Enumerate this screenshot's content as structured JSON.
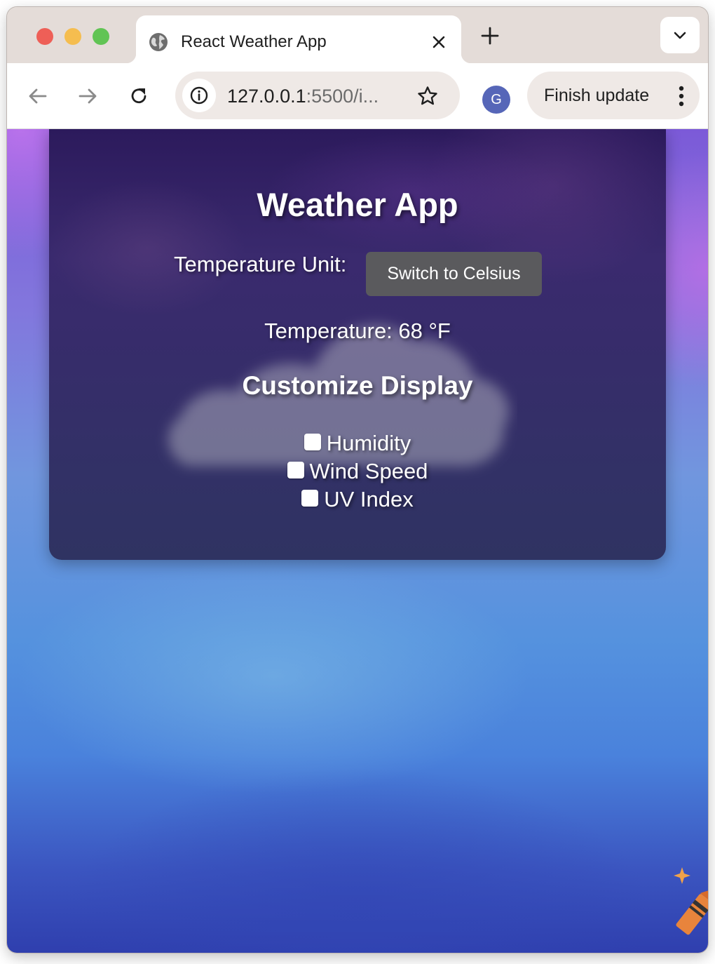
{
  "browser": {
    "tab_title": "React Weather App",
    "url_host": "127.0.0.1",
    "url_rest": ":5500/i...",
    "profile_initial": "G",
    "finish_update_label": "Finish update",
    "icons": {
      "favicon": "globe-icon",
      "close": "close-icon",
      "new_tab": "plus-icon",
      "tab_menu": "chevron-down-icon",
      "back": "arrow-left-icon",
      "forward": "arrow-right-icon",
      "reload": "reload-icon",
      "site_info": "info-icon",
      "bookmark": "star-icon",
      "menu": "kebab-menu-icon"
    }
  },
  "app": {
    "title": "Weather App",
    "unit_label": "Temperature Unit:",
    "unit_button": "Switch to Celsius",
    "temperature_text": "Temperature: 68 °F",
    "customize_title": "Customize Display",
    "options": [
      {
        "label": "Humidity",
        "checked": false
      },
      {
        "label": "Wind Speed",
        "checked": false
      },
      {
        "label": "UV Index",
        "checked": false
      }
    ]
  },
  "colors": {
    "button_bg": "#5a5a5d",
    "card_bg": "#2f2a63",
    "avatar_bg": "#5666b8"
  }
}
